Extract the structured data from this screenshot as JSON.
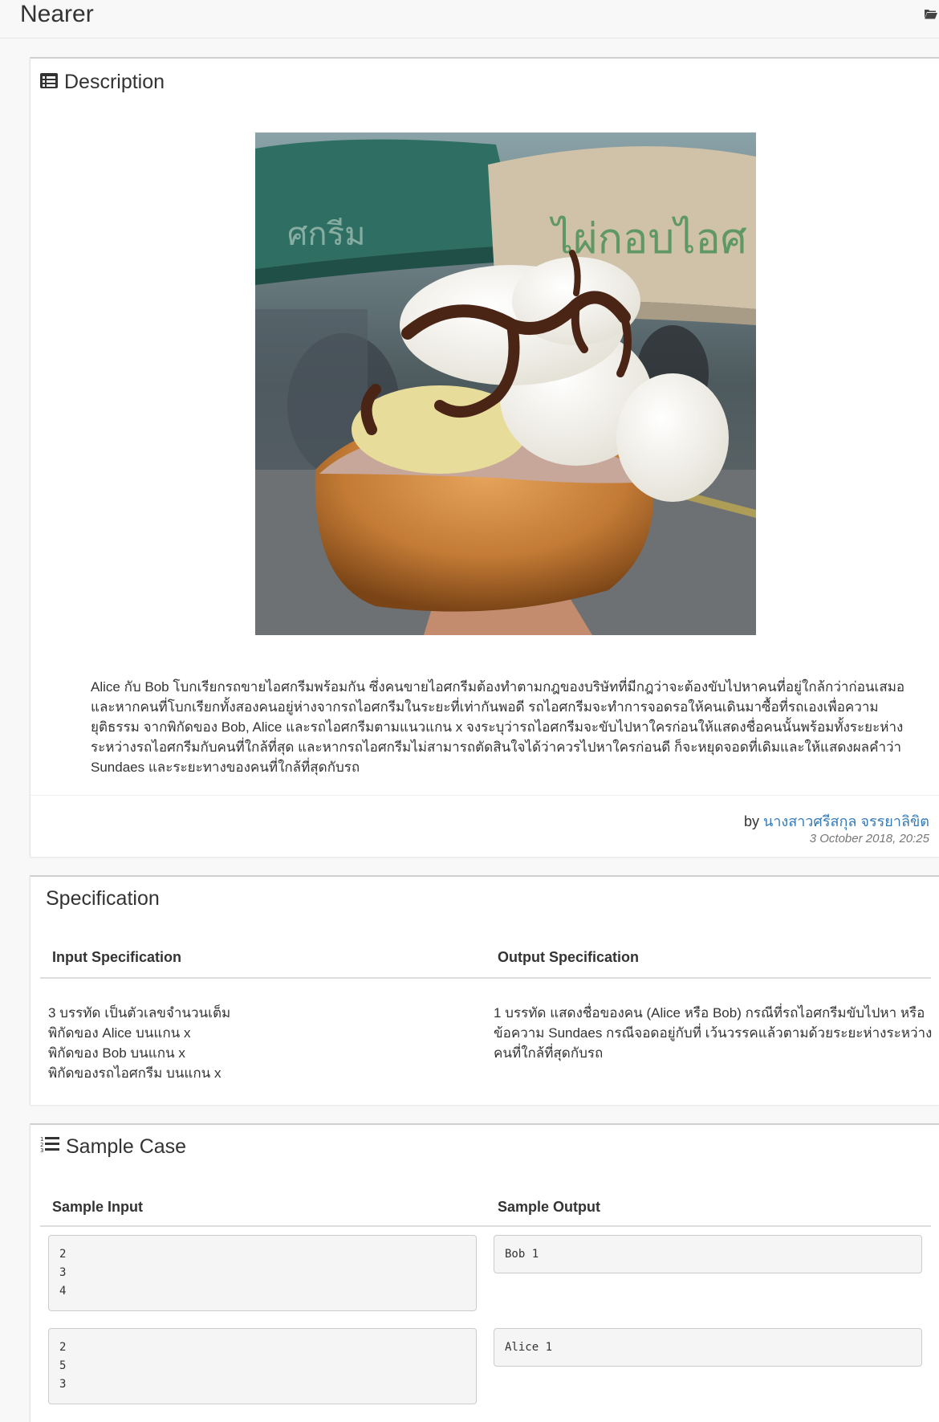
{
  "app": {
    "title": "Nearer",
    "folder_icon": "folder-icon"
  },
  "description": {
    "heading": "Description",
    "icon": "list-alt-icon",
    "photo_icon": "ice-cream-sandwich-photo",
    "text": "Alice กับ Bob โบกเรียกรถขายไอศกรีมพร้อมกัน ซึ่งคนขายไอศกรีมต้องทำตามกฎของบริษัทที่มีกฎว่าจะต้องขับไปหาคนที่อยู่ใกล้กว่าก่อนเสมอ และหากคนที่โบกเรียกทั้งสองคนอยู่ห่างจากรถไอศกรีมในระยะที่เท่ากันพอดี รถไอศกรีมจะทำการจอดรอให้คนเดินมาซื้อที่รถเองเพื่อความยุติธรรม จากพิกัดของ Bob, Alice และรถไอศกรีมตามแนวแกน x จงระบุว่ารถไอศกรีมจะขับไปหาใครก่อนให้แสดงชื่อคนนั้นพร้อมทั้งระยะห่างระหว่างรถไอศกรีมกับคนที่ใกล้ที่สุด และหากรถไอศกรีมไม่สามารถตัดสินใจได้ว่าควรไปหาใครก่อนดี ก็จะหยุดจอดที่เดิมและให้แสดงผลคำว่า Sundaes และระยะทางของคนที่ใกล้ที่สุดกับรถ",
    "by_prefix": "by",
    "author": "นางสาวศรีสกุล จรรยาลิขิต",
    "timestamp": "3 October 2018, 20:25"
  },
  "specification": {
    "heading": "Specification",
    "input_header": "Input Specification",
    "output_header": "Output Specification",
    "input_lines": [
      "3 บรรทัด เป็นตัวเลขจำนวนเต็ม",
      "พิกัดของ Alice บนแกน x",
      "พิกัดของ Bob บนแกน x",
      "พิกัดของรถไอศกรีม บนแกน x"
    ],
    "output_lines": [
      "1 บรรทัด แสดงชื่อของคน (Alice หรือ Bob) กรณีที่รถไอศกรีมขับไปหา หรือ",
      "ข้อความ Sundaes กรณีจอดอยู่กับที่ เว้นวรรคแล้วตามด้วยระยะห่างระหว่าง",
      "คนที่ใกล้ที่สุดกับรถ"
    ]
  },
  "sample": {
    "heading": "Sample Case",
    "icon": "list-ol-icon",
    "input_header": "Sample Input",
    "output_header": "Sample Output",
    "cases": [
      {
        "input": [
          "2",
          "3",
          "4"
        ],
        "output": [
          "Bob 1"
        ]
      },
      {
        "input": [
          "2",
          "5",
          "3"
        ],
        "output": [
          "Alice 1"
        ]
      }
    ]
  },
  "colors": {
    "link": "#337ab7",
    "panel_bg": "#ffffff",
    "page_bg": "#f8f8f8",
    "code_bg": "#f5f5f5",
    "muted": "#777777"
  }
}
